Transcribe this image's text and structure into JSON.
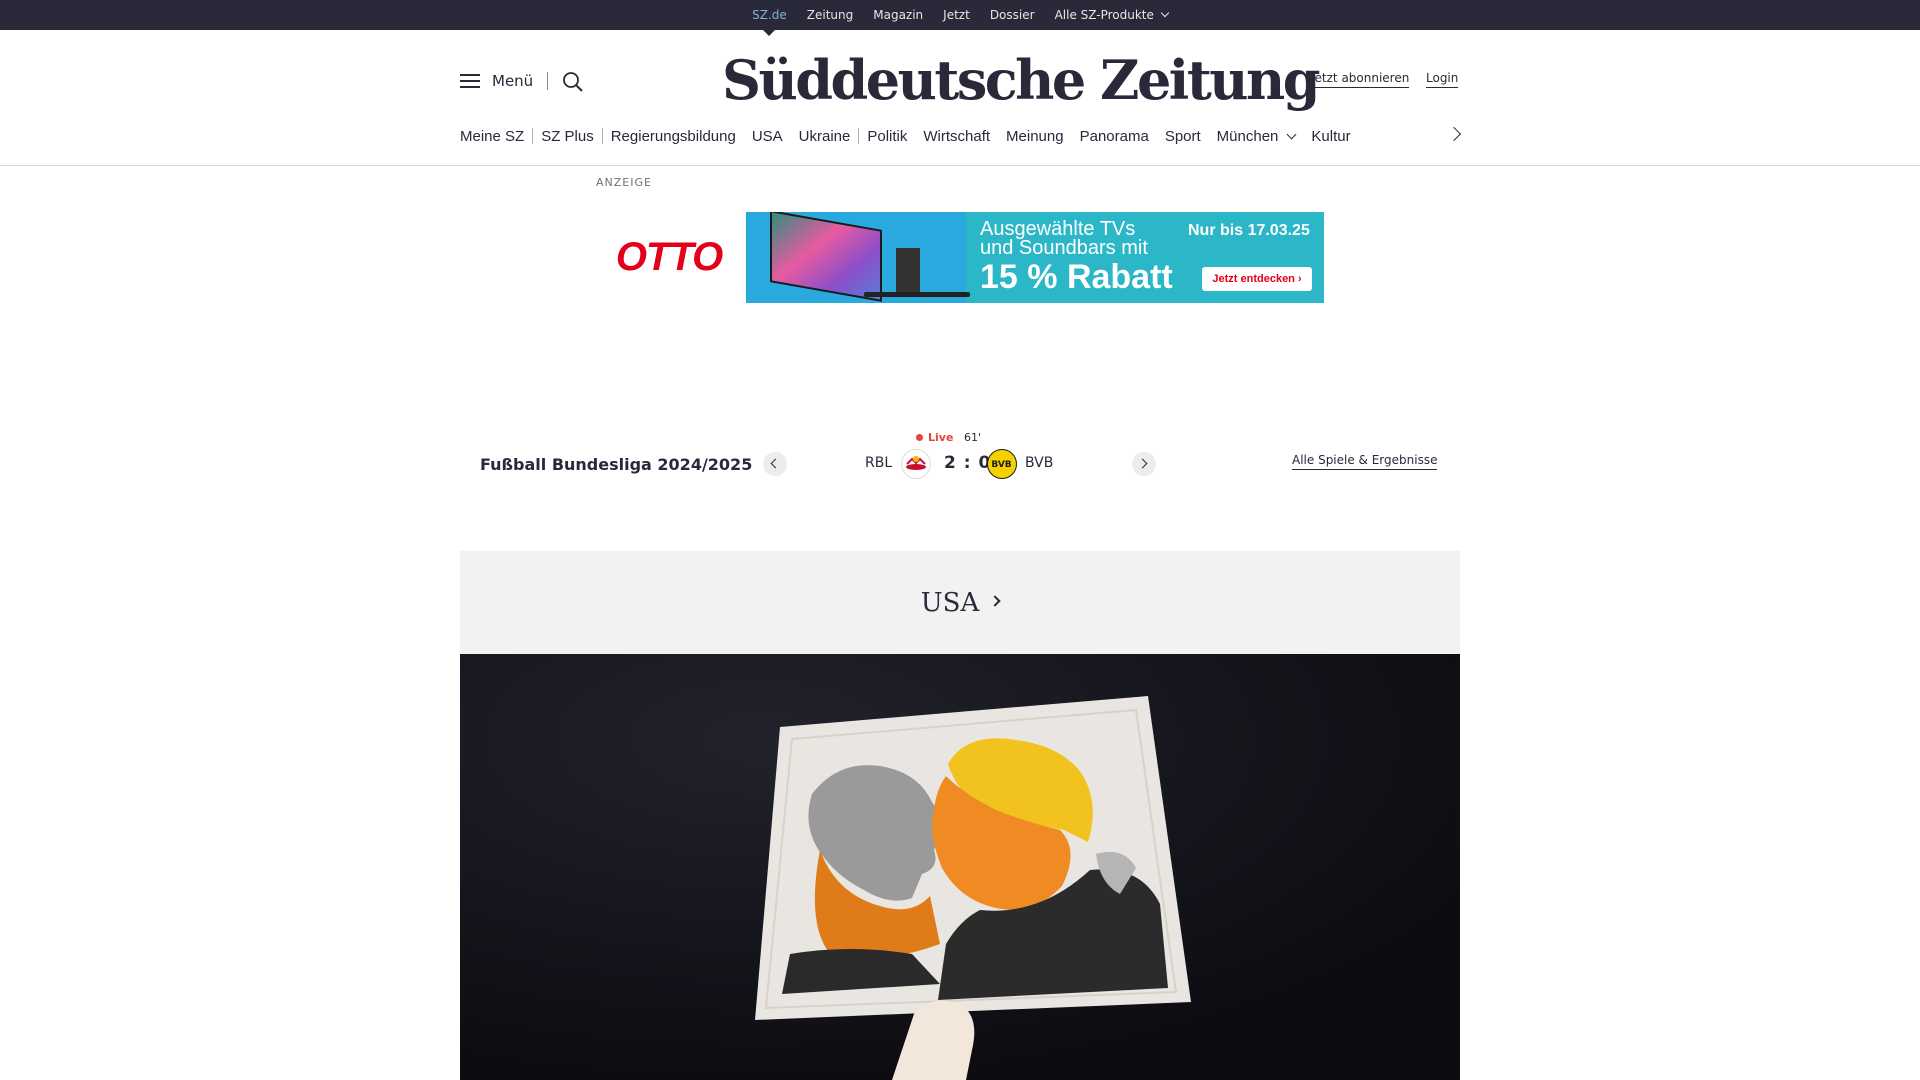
{
  "topbar": {
    "links": [
      "SZ.de",
      "Zeitung",
      "Magazin",
      "Jetzt",
      "Dossier"
    ],
    "products": "Alle SZ-Produkte"
  },
  "header": {
    "menu_label": "Menü",
    "logo": "Süddeutsche Zeitung",
    "subscribe": "Jetzt abonnieren",
    "login": "Login"
  },
  "nav": {
    "items": [
      "Meine SZ",
      "SZ Plus",
      "Regierungsbildung",
      "USA",
      "Ukraine",
      "Politik",
      "Wirtschaft",
      "Meinung",
      "Panorama",
      "Sport",
      "München",
      "Kultur"
    ]
  },
  "ad": {
    "label": "ANZEIGE",
    "brand": "OTTO",
    "line1": "Ausgewählte TVs",
    "line2": "und Soundbars mit",
    "big": "15 % Rabatt",
    "date": "Nur bis 17.03.25",
    "cta": "Jetzt entdecken ›",
    "brand_color": "#e4001b",
    "banner_color": "#2bb7c7"
  },
  "score": {
    "league": "Fußball Bundesliga 2024/2025",
    "live": "Live",
    "minute": "61'",
    "home": "RBL",
    "away": "BVB",
    "result": "2 : 0",
    "all_games": "Alle Spiele & Ergebnisse",
    "live_color": "#e8413e"
  },
  "section": {
    "title": "USA"
  },
  "colors": {
    "dark": "#29293a",
    "topbar_active": "#7fb3d5"
  }
}
